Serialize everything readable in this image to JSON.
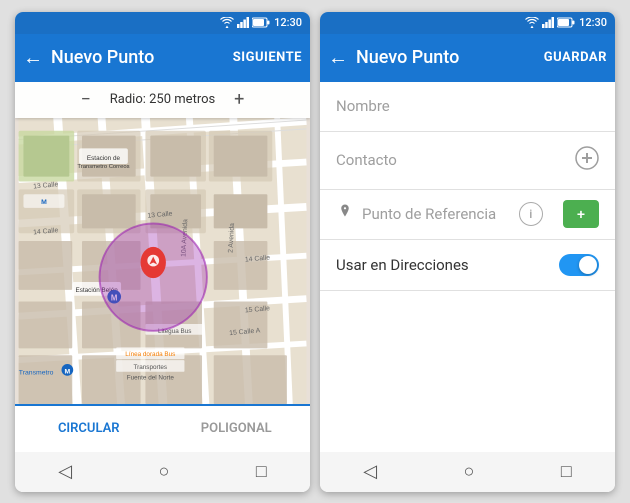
{
  "screen1": {
    "statusBar": {
      "time": "12:30"
    },
    "toolbar": {
      "title": "Nuevo Punto",
      "backLabel": "←",
      "actionLabel": "SIGUIENTE"
    },
    "radius": {
      "label": "Radio: 250 metros",
      "minusBtn": "−",
      "plusBtn": "+"
    },
    "tabs": [
      {
        "id": "circular",
        "label": "CIRCULAR",
        "active": true
      },
      {
        "id": "poligonal",
        "label": "POLIGONAL",
        "active": false
      }
    ],
    "navBar": {
      "back": "◁",
      "home": "○",
      "recent": "□"
    }
  },
  "screen2": {
    "statusBar": {
      "time": "12:30"
    },
    "toolbar": {
      "title": "Nuevo Punto",
      "backLabel": "←",
      "actionLabel": "GUARDAR"
    },
    "form": {
      "fields": [
        {
          "id": "nombre",
          "placeholder": "Nombre",
          "hasIcon": false
        },
        {
          "id": "contacto",
          "placeholder": "Contacto",
          "hasIcon": true,
          "icon": "+"
        }
      ],
      "referencia": {
        "pinIcon": "📌",
        "label": "Punto de Referencia",
        "infoIcon": "i",
        "addLabel": "+"
      },
      "toggle": {
        "label": "Usar en Direcciones",
        "value": true
      }
    },
    "navBar": {
      "back": "◁",
      "home": "○",
      "recent": "□"
    }
  }
}
